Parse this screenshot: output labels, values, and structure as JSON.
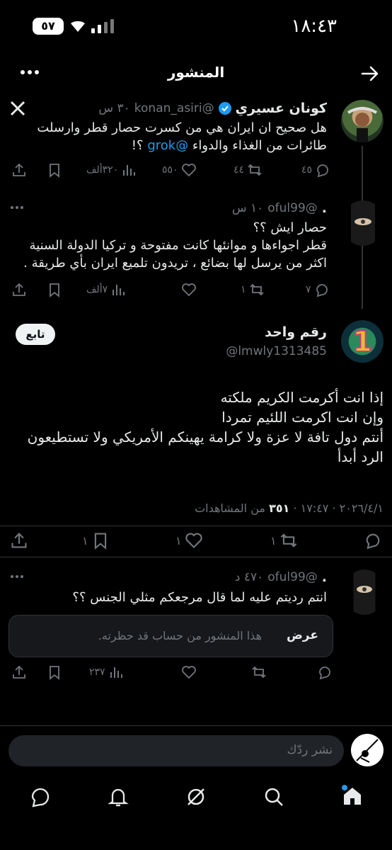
{
  "status_bar": {
    "time": "١٨:٤٣",
    "battery": "٥٧"
  },
  "header": {
    "title": "المنشور"
  },
  "post1": {
    "name": "كونان عسيري",
    "handle": "@konan_asiri",
    "time": "٣٠ س",
    "text_line1": "هل صحيح ان ايران هي من كسرت حصار قطر وارسلت",
    "text_line2_before": "طائرات من الغذاء والدواء",
    "text_mention": "@grok",
    "text_line2_after": "؟!",
    "replies": "٤٥",
    "reposts": "٤٤",
    "likes": "٥٥٠",
    "views": "٣٢٠ألف"
  },
  "post2": {
    "name": ".",
    "handle": "@oful99",
    "time": "١٠ س",
    "lines": [
      "حصار ايش ؟؟",
      "قطر اجواءها و موانئها كانت مفتوحة و تركيا الدولة السنية",
      "اكثر من يرسل لها بضائع ، تريدون تلميع ايران بأي طريقة ."
    ],
    "replies": "٧",
    "reposts": "١",
    "views": "٧ألف"
  },
  "main_post": {
    "name": "رقم واحد",
    "handle": "@lmwly1313485",
    "follow_label": "تابع",
    "lines": [
      "إذا انت أكرمت الكريم ملكته",
      "وإن انت اكرمت اللئيم تمردا",
      "أنتم دول تافة لا عزة ولا كرامة يهينكم الأمريكي ولا تستطيعون",
      "الرد أبدأ"
    ],
    "meta_date": "٢٠٢٦/٤/١ · ١٧:٤٧ ·",
    "meta_views": "٣٥١",
    "meta_views_label": "من المشاهدات",
    "reposts": "١",
    "likes": "١",
    "bookmarks": "١"
  },
  "reply3": {
    "name": ".",
    "handle": "@oful99",
    "time": "٤٧٠ د",
    "text": "انتم رديتم عليه لما قال مرجعكم مثلي الجنس ؟؟",
    "blocked_text": "هذا المنشور من حساب قد حظرته.",
    "blocked_action": "عرض",
    "views": "٢٣٧"
  },
  "reply_bar": {
    "placeholder": "نشر ردّك"
  },
  "colors": {
    "accent": "#1d9bf0",
    "muted": "#71767b",
    "bg": "#000000"
  }
}
